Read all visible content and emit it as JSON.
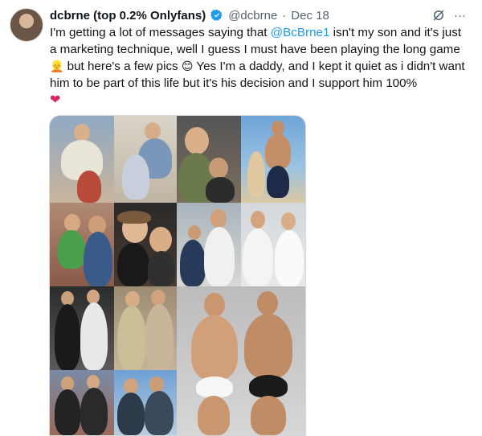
{
  "tweet": {
    "display_name": "dcbrne (top 0.2% Onlyfans)",
    "handle": "@dcbrne",
    "separator": "·",
    "date": "Dec 18",
    "text_parts": {
      "p1": "I'm getting a lot of messages saying that ",
      "mention": "@BcBrne1",
      "p2": " isn't my son and it's just a marketing technique, well I guess I must have been playing the long game ",
      "p3": " but here's a few pics ",
      "p4": " Yes I'm a daddy, and I kept it quiet as i didn't want him to be part of this life but it's his decision and I support him 100% "
    },
    "emoji_1": "👱",
    "emoji_2": "😊",
    "emoji_3": "❤",
    "colors": {
      "accent": "#1d9bf0",
      "text": "#0f1419",
      "secondary": "#536471",
      "heart": "#e0245e"
    }
  },
  "media": {
    "alt": "photo collage"
  }
}
